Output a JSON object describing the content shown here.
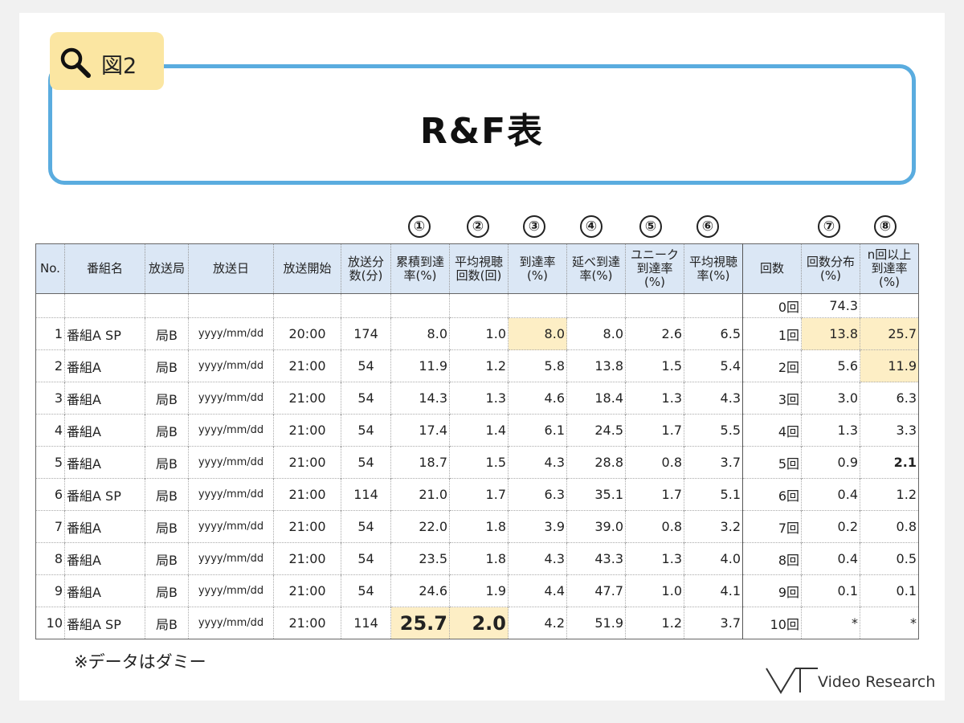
{
  "tag": {
    "label": "図2",
    "icon": "magnifier-icon"
  },
  "title": "R&F表",
  "circle_markers": [
    "①",
    "②",
    "③",
    "④",
    "⑤",
    "⑥",
    "⑦",
    "⑧"
  ],
  "table": {
    "headers": {
      "no": "No.",
      "program": "番組名",
      "station": "放送局",
      "date": "放送日",
      "start": "放送開始",
      "minutes": "放送分\n数(分)",
      "cum_reach": "累積到達\n率(%)",
      "avg_freq": "平均視聴\n回数(回)",
      "reach": "到達率\n(%)",
      "total_reach": "延べ到達\n率(%)",
      "unique_reach": "ユニーク\n到達率\n(%)",
      "avg_rating": "平均視聴\n率(%)",
      "times": "回数",
      "freq_dist": "回数分布\n(%)",
      "n_plus": "n回以上\n到達率\n(%)"
    },
    "zero_row": {
      "times": "0回",
      "freq_dist": "74.3"
    },
    "rows": [
      {
        "no": "1",
        "program": "番組A SP",
        "station": "局B",
        "date": "yyyy/mm/dd",
        "start": "20:00",
        "minutes": "174",
        "cum_reach": "8.0",
        "avg_freq": "1.0",
        "reach": "8.0",
        "total_reach": "8.0",
        "unique_reach": "2.6",
        "avg_rating": "6.5",
        "times": "1回",
        "freq_dist": "13.8",
        "n_plus": "25.7"
      },
      {
        "no": "2",
        "program": "番組A",
        "station": "局B",
        "date": "yyyy/mm/dd",
        "start": "21:00",
        "minutes": "54",
        "cum_reach": "11.9",
        "avg_freq": "1.2",
        "reach": "5.8",
        "total_reach": "13.8",
        "unique_reach": "1.5",
        "avg_rating": "5.4",
        "times": "2回",
        "freq_dist": "5.6",
        "n_plus": "11.9"
      },
      {
        "no": "3",
        "program": "番組A",
        "station": "局B",
        "date": "yyyy/mm/dd",
        "start": "21:00",
        "minutes": "54",
        "cum_reach": "14.3",
        "avg_freq": "1.3",
        "reach": "4.6",
        "total_reach": "18.4",
        "unique_reach": "1.3",
        "avg_rating": "4.3",
        "times": "3回",
        "freq_dist": "3.0",
        "n_plus": "6.3"
      },
      {
        "no": "4",
        "program": "番組A",
        "station": "局B",
        "date": "yyyy/mm/dd",
        "start": "21:00",
        "minutes": "54",
        "cum_reach": "17.4",
        "avg_freq": "1.4",
        "reach": "6.1",
        "total_reach": "24.5",
        "unique_reach": "1.7",
        "avg_rating": "5.5",
        "times": "4回",
        "freq_dist": "1.3",
        "n_plus": "3.3"
      },
      {
        "no": "5",
        "program": "番組A",
        "station": "局B",
        "date": "yyyy/mm/dd",
        "start": "21:00",
        "minutes": "54",
        "cum_reach": "18.7",
        "avg_freq": "1.5",
        "reach": "4.3",
        "total_reach": "28.8",
        "unique_reach": "0.8",
        "avg_rating": "3.7",
        "times": "5回",
        "freq_dist": "0.9",
        "n_plus": "2.1"
      },
      {
        "no": "6",
        "program": "番組A SP",
        "station": "局B",
        "date": "yyyy/mm/dd",
        "start": "21:00",
        "minutes": "114",
        "cum_reach": "21.0",
        "avg_freq": "1.7",
        "reach": "6.3",
        "total_reach": "35.1",
        "unique_reach": "1.7",
        "avg_rating": "5.1",
        "times": "6回",
        "freq_dist": "0.4",
        "n_plus": "1.2"
      },
      {
        "no": "7",
        "program": "番組A",
        "station": "局B",
        "date": "yyyy/mm/dd",
        "start": "21:00",
        "minutes": "54",
        "cum_reach": "22.0",
        "avg_freq": "1.8",
        "reach": "3.9",
        "total_reach": "39.0",
        "unique_reach": "0.8",
        "avg_rating": "3.2",
        "times": "7回",
        "freq_dist": "0.2",
        "n_plus": "0.8"
      },
      {
        "no": "8",
        "program": "番組A",
        "station": "局B",
        "date": "yyyy/mm/dd",
        "start": "21:00",
        "minutes": "54",
        "cum_reach": "23.5",
        "avg_freq": "1.8",
        "reach": "4.3",
        "total_reach": "43.3",
        "unique_reach": "1.3",
        "avg_rating": "4.0",
        "times": "8回",
        "freq_dist": "0.4",
        "n_plus": "0.5"
      },
      {
        "no": "9",
        "program": "番組A",
        "station": "局B",
        "date": "yyyy/mm/dd",
        "start": "21:00",
        "minutes": "54",
        "cum_reach": "24.6",
        "avg_freq": "1.9",
        "reach": "4.4",
        "total_reach": "47.7",
        "unique_reach": "1.0",
        "avg_rating": "4.1",
        "times": "9回",
        "freq_dist": "0.1",
        "n_plus": "0.1"
      },
      {
        "no": "10",
        "program": "番組A SP",
        "station": "局B",
        "date": "yyyy/mm/dd",
        "start": "21:00",
        "minutes": "114",
        "cum_reach": "25.7",
        "avg_freq": "2.0",
        "reach": "4.2",
        "total_reach": "51.9",
        "unique_reach": "1.2",
        "avg_rating": "3.7",
        "times": "10回",
        "freq_dist": "*",
        "n_plus": "*"
      }
    ]
  },
  "note": "※データはダミー",
  "logo": {
    "text": "Video Research"
  },
  "colors": {
    "border_blue": "#5aacdf",
    "tag_yellow": "#fbe6a2",
    "header_blue": "#dbe7f5",
    "highlight": "#fdeec5"
  }
}
